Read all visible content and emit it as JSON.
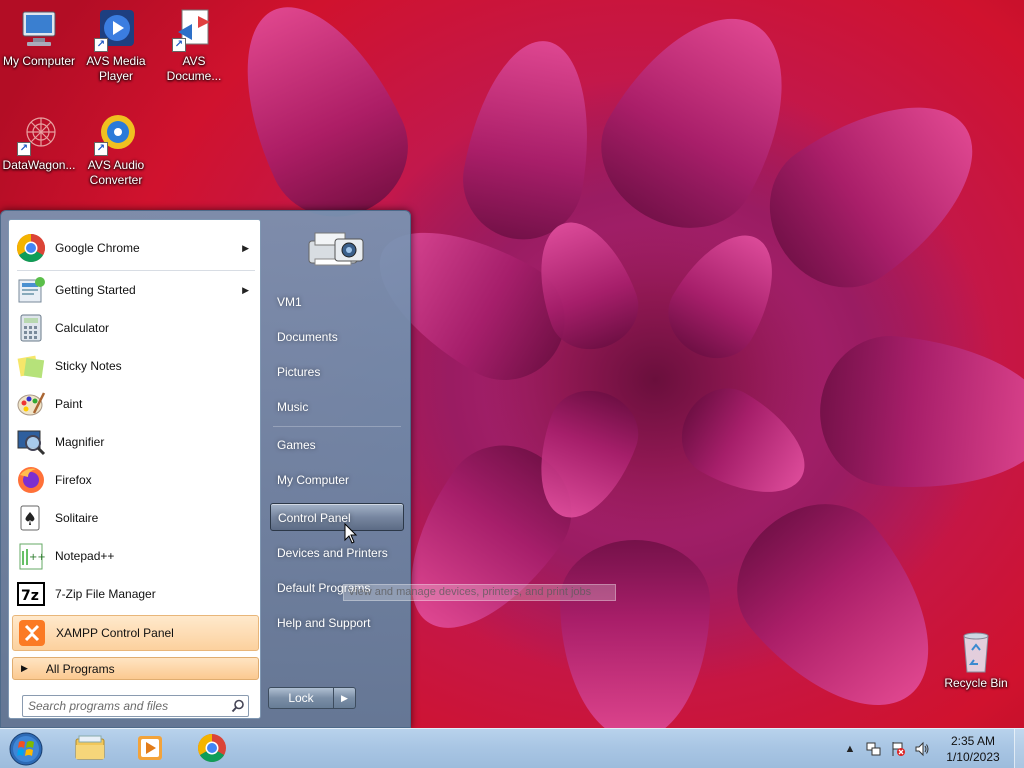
{
  "desktop": {
    "icons": [
      {
        "label": "My Computer",
        "icon": "computer-icon"
      },
      {
        "label": "AVS Media Player",
        "icon": "media-player-icon"
      },
      {
        "label": "AVS Docume...",
        "icon": "document-converter-icon"
      },
      {
        "label": "DataWagon...",
        "icon": "datawagon-icon"
      },
      {
        "label": "AVS Audio Converter",
        "icon": "audio-converter-icon"
      },
      {
        "label": "Recycle Bin",
        "icon": "recycle-bin-icon"
      }
    ]
  },
  "start_menu": {
    "programs": [
      {
        "label": "Google Chrome",
        "icon": "chrome-icon",
        "has_submenu": true
      },
      {
        "label": "Getting Started",
        "icon": "getting-started-icon",
        "has_submenu": true
      },
      {
        "label": "Calculator",
        "icon": "calculator-icon"
      },
      {
        "label": "Sticky Notes",
        "icon": "sticky-notes-icon"
      },
      {
        "label": "Paint",
        "icon": "paint-icon"
      },
      {
        "label": "Magnifier",
        "icon": "magnifier-icon"
      },
      {
        "label": "Firefox",
        "icon": "firefox-icon"
      },
      {
        "label": "Solitaire",
        "icon": "solitaire-icon"
      },
      {
        "label": "Notepad++",
        "icon": "notepadpp-icon"
      },
      {
        "label": "7-Zip File Manager",
        "icon": "7zip-icon"
      },
      {
        "label": "XAMPP Control Panel",
        "icon": "xampp-icon",
        "highlighted": true
      }
    ],
    "all_programs_label": "All Programs",
    "search": {
      "placeholder": "Search programs and files"
    },
    "right_items": [
      {
        "label": "VM1"
      },
      {
        "label": "Documents"
      },
      {
        "label": "Pictures"
      },
      {
        "label": "Music"
      },
      {
        "label": "Games"
      },
      {
        "label": "My Computer"
      },
      {
        "label": "Control Panel",
        "highlighted": true
      },
      {
        "label": "Devices and Printers"
      },
      {
        "label": "Default Programs"
      },
      {
        "label": "Help and Support"
      }
    ],
    "lock_label": "Lock",
    "tooltip": "View and manage devices, printers, and print jobs"
  },
  "taskbar": {
    "pinned": [
      {
        "name": "windows-explorer-icon"
      },
      {
        "name": "media-player-icon"
      },
      {
        "name": "chrome-icon"
      }
    ],
    "clock": {
      "time": "2:35 AM",
      "date": "1/10/2023"
    }
  },
  "colors": {
    "highlight_orange": "#fcd19e",
    "start_menu_blue": "#6f8fb0",
    "taskbar": "#a9c6e4"
  }
}
